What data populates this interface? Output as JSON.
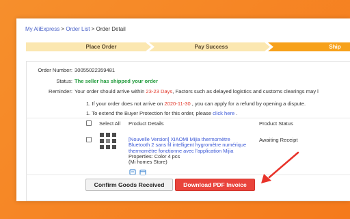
{
  "breadcrumb": {
    "home": "My AliExpress",
    "sep1": " > ",
    "orders": "Order List",
    "sep2": " > ",
    "current": "Order Detail"
  },
  "steps": [
    {
      "label": "Place Order",
      "state": "done"
    },
    {
      "label": "Pay Success",
      "state": "done"
    },
    {
      "label": "Ship",
      "state": "active"
    }
  ],
  "order": {
    "number_label": "Order Number:",
    "number_value": "30055022359481",
    "status_label": "Status:",
    "status_value": "The seller has shipped your order",
    "reminder_label": "Reminder:",
    "reminder_pre": "Your order should arrive within ",
    "reminder_days": "23-23 Days",
    "reminder_post": ", Factors such as delayed logistics and customs clearings may l",
    "refund_pre": "1. If your order does not arrive on ",
    "refund_date": "2020-11-30",
    "refund_post": " , you can apply for a refund by opening a dispute.",
    "protection_pre": "1. To extend the Buyer Protection for this order, please ",
    "protection_link": "click here",
    "protection_post": " ."
  },
  "table": {
    "select_all": "Select All",
    "col_details": "Product Details",
    "col_status": "Product Status"
  },
  "product": {
    "title_lines": [
      "[Nouvelle Version] XIAOMI Mijia thermomètre",
      "Bluetooth 2 sans fil intelligent hygromètre numérique",
      "thermomètre fonctionne avec l'application Mijia"
    ],
    "properties": "Properties: Color 4 pcs",
    "store": "(Mi homes Store)",
    "status": "Awaiting Receipt"
  },
  "buttons": {
    "confirm": "Confirm Goods Received",
    "download": "Download PDF Invoice"
  },
  "colors": {
    "background": "#f68f2c",
    "step_active": "#f7a11a",
    "step_done": "#fbe7b0",
    "accent_red": "#e9443c",
    "link_blue": "#3a57d6",
    "status_green": "#1f9a3a"
  },
  "icons": [
    "document-icon",
    "calendar-icon",
    "arrow-pointer-icon"
  ]
}
